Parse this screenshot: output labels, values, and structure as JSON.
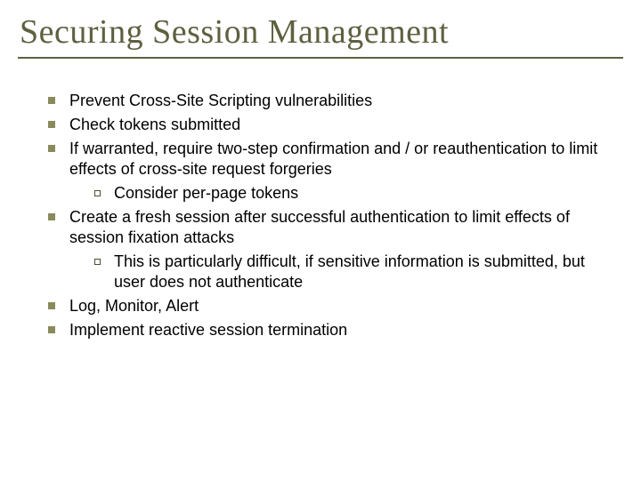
{
  "title": "Securing Session Management",
  "bullets": {
    "b0": "Prevent Cross-Site Scripting vulnerabilities",
    "b1": "Check tokens submitted",
    "b2": "If warranted, require two-step confirmation and / or reauthentication to limit effects of cross-site request forgeries",
    "b2s0": "Consider per-page tokens",
    "b3": "Create a fresh session after successful authentication to limit effects of session fixation attacks",
    "b3s0": "This is particularly difficult, if sensitive information is submitted, but user does not authenticate",
    "b4": "Log, Monitor, Alert",
    "b5": "Implement reactive session termination"
  }
}
